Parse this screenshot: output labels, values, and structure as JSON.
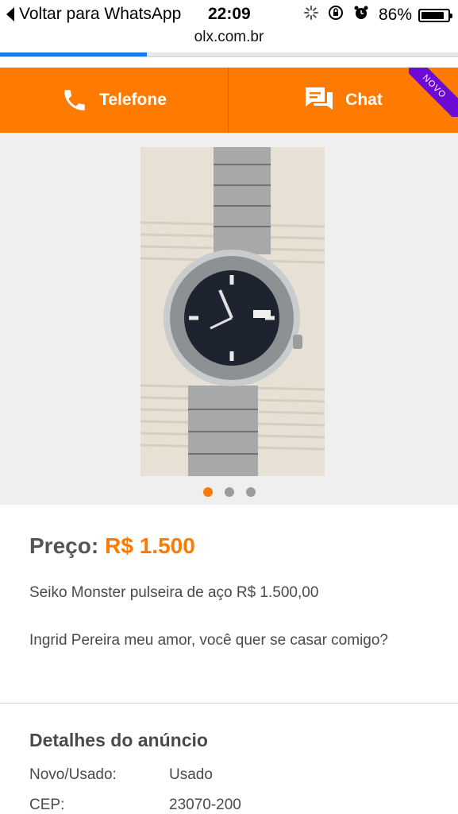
{
  "status_bar": {
    "back_label": "Voltar para WhatsApp",
    "time": "22:09",
    "battery": "86%",
    "battery_level": 0.86
  },
  "browser": {
    "url": "olx.com.br",
    "load_progress": 0.32
  },
  "actions": {
    "phone_label": "Telefone",
    "chat_label": "Chat",
    "new_badge": "NOVO"
  },
  "gallery": {
    "image_count": 3,
    "active_index": 0
  },
  "listing": {
    "price_label": "Preço:",
    "price_value": "R$ 1.500",
    "title": "Seiko Monster pulseira de aço R$ 1.500,00",
    "description": "Ingrid Pereira meu amor, você quer se casar comigo?"
  },
  "details": {
    "heading": "Detalhes do anúncio",
    "rows": [
      {
        "label": "Novo/Usado:",
        "value": "Usado"
      },
      {
        "label": "CEP:",
        "value": "23070-200"
      }
    ]
  },
  "colors": {
    "accent": "#ff7a00",
    "badge": "#6e0ad6",
    "progress": "#1a7be6"
  }
}
